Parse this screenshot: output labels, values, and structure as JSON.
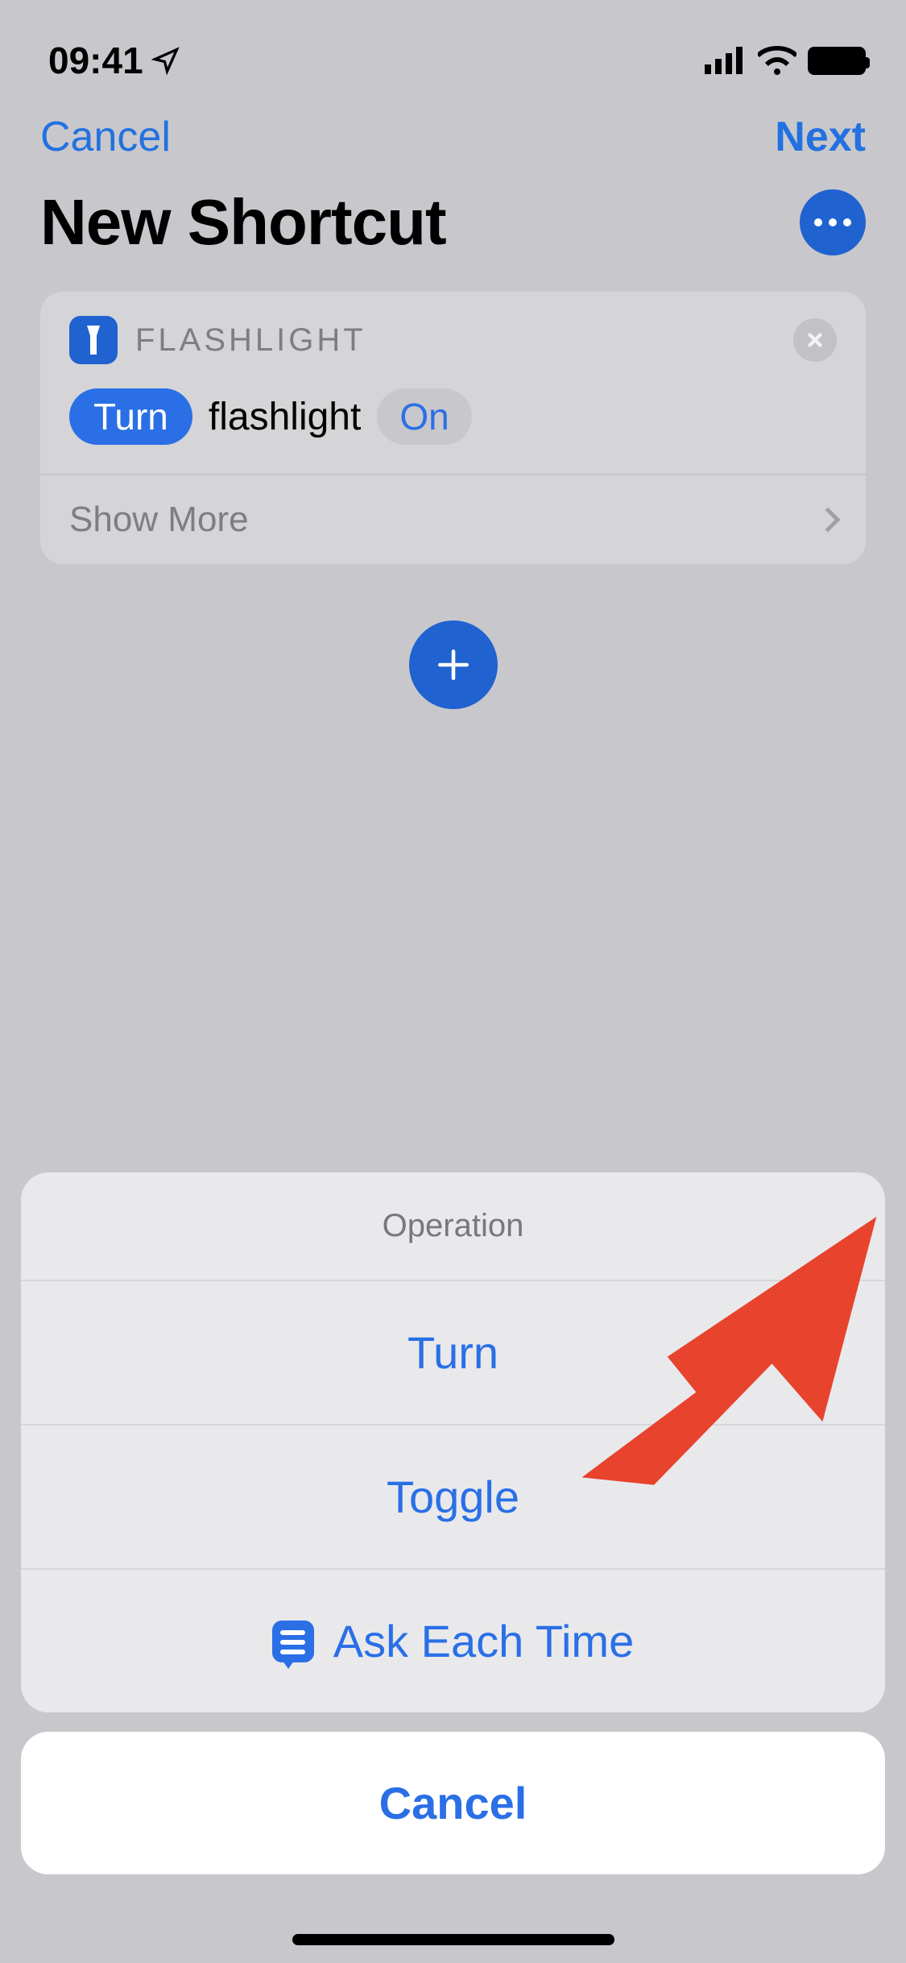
{
  "status": {
    "time": "09:41"
  },
  "nav": {
    "cancel": "Cancel",
    "next": "Next"
  },
  "header": {
    "title": "New Shortcut"
  },
  "action_card": {
    "app_label": "FLASHLIGHT",
    "operation_pill": "Turn",
    "subject": "flashlight",
    "state_pill": "On",
    "show_more": "Show More"
  },
  "sheet": {
    "title": "Operation",
    "options": [
      {
        "label": "Turn",
        "selected": true
      },
      {
        "label": "Toggle",
        "selected": false
      }
    ],
    "ask_each_time": "Ask Each Time",
    "cancel": "Cancel"
  }
}
